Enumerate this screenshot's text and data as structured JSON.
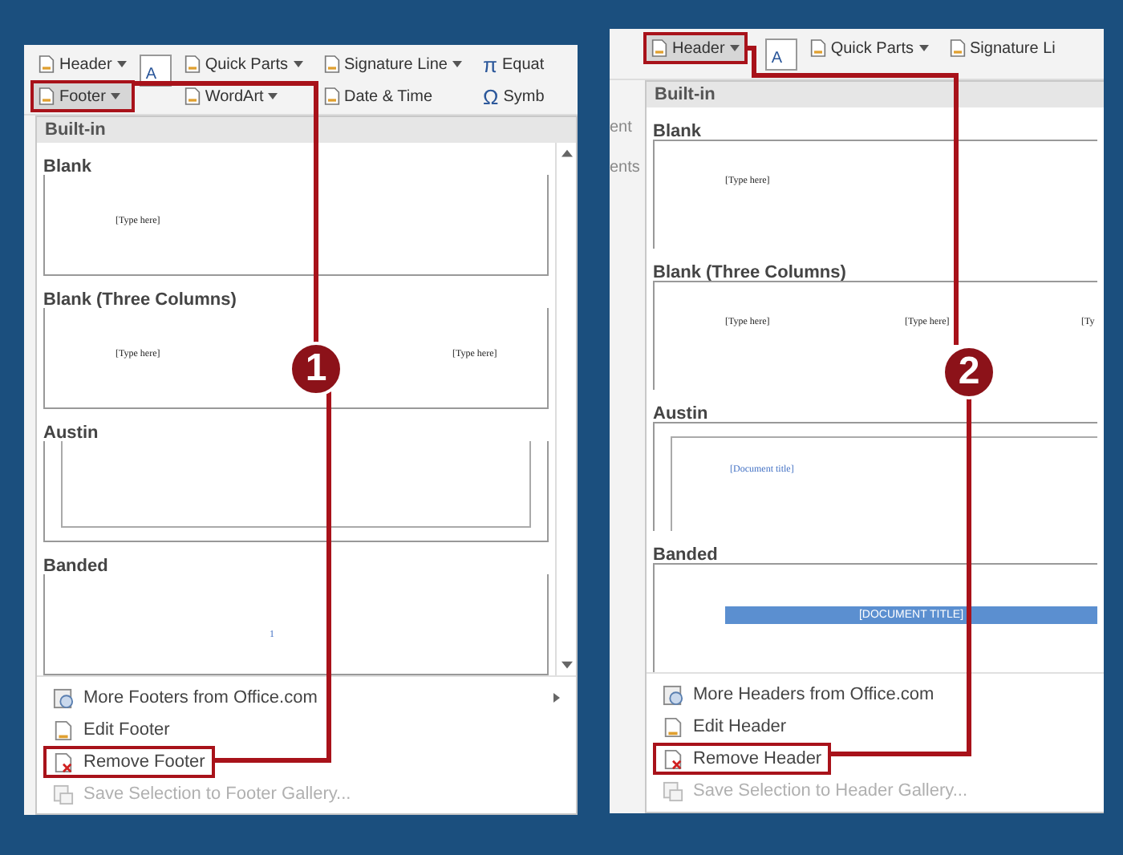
{
  "panels": [
    {
      "ribbon_groups": [
        [
          {
            "label": "Header",
            "kind": "dropdown",
            "highlighted": false
          },
          {
            "label": "Footer",
            "kind": "dropdown",
            "highlighted": true
          }
        ],
        [
          {
            "label": "A",
            "kind": "textbox"
          }
        ],
        [
          {
            "label": "Quick Parts",
            "kind": "dropdown",
            "highlighted": false
          },
          {
            "label": "WordArt",
            "kind": "dropdown",
            "highlighted": false
          }
        ],
        [
          {
            "label": "Signature Line",
            "kind": "dropdown",
            "highlighted": false
          },
          {
            "label": "Date & Time",
            "kind": "plain",
            "highlighted": false
          }
        ],
        [
          {
            "label": "Equat",
            "kind": "symbol",
            "symbol": "π",
            "highlighted": false
          },
          {
            "label": "Symb",
            "kind": "symbol",
            "symbol": "Ω",
            "highlighted": false
          }
        ]
      ],
      "menu": {
        "heading": "Built-in",
        "scrollbar": true,
        "gallery": [
          {
            "name": "Blank",
            "texts": [
              "[Type here]"
            ]
          },
          {
            "name": "Blank (Three Columns)",
            "texts": [
              "[Type here]",
              "[Type here]"
            ]
          },
          {
            "name": "Austin"
          },
          {
            "name": "Banded",
            "texts": [
              "1"
            ]
          }
        ],
        "commands": [
          {
            "label": "More Footers from Office.com",
            "kind": "more",
            "submenu": true,
            "disabled": false,
            "highlighted": false
          },
          {
            "label": "Edit Footer",
            "kind": "edit",
            "submenu": false,
            "disabled": false,
            "highlighted": false
          },
          {
            "label": "Remove Footer",
            "kind": "remove",
            "submenu": false,
            "disabled": false,
            "highlighted": true
          },
          {
            "label": "Save Selection to Footer Gallery...",
            "kind": "save",
            "submenu": false,
            "disabled": true,
            "highlighted": false
          }
        ]
      },
      "callout": {
        "number": "1"
      }
    },
    {
      "side_fragments": [
        "ent",
        "ents"
      ],
      "ribbon_groups": [
        [
          {
            "label": "Header",
            "kind": "dropdown",
            "highlighted": true
          }
        ],
        [
          {
            "label": "A",
            "kind": "textbox"
          }
        ],
        [
          {
            "label": "Quick Parts",
            "kind": "dropdown",
            "highlighted": false
          }
        ],
        [
          {
            "label": "Signature Li",
            "kind": "plain",
            "highlighted": false
          }
        ]
      ],
      "menu": {
        "heading": "Built-in",
        "scrollbar": false,
        "gallery": [
          {
            "name": "Blank",
            "texts": [
              "[Type here]"
            ]
          },
          {
            "name": "Blank (Three Columns)",
            "texts": [
              "[Type here]",
              "[Type here]",
              "[Ty"
            ]
          },
          {
            "name": "Austin",
            "texts": [
              "[Document title]"
            ]
          },
          {
            "name": "Banded",
            "texts": [
              "[DOCUMENT TITLE]"
            ]
          }
        ],
        "commands": [
          {
            "label": "More Headers from Office.com",
            "kind": "more",
            "submenu": false,
            "disabled": false,
            "highlighted": false
          },
          {
            "label": "Edit Header",
            "kind": "edit",
            "submenu": false,
            "disabled": false,
            "highlighted": false
          },
          {
            "label": "Remove Header",
            "kind": "remove",
            "submenu": false,
            "disabled": false,
            "highlighted": true
          },
          {
            "label": "Save Selection to Header Gallery...",
            "kind": "save",
            "submenu": false,
            "disabled": true,
            "highlighted": false
          }
        ]
      },
      "callout": {
        "number": "2"
      }
    }
  ]
}
